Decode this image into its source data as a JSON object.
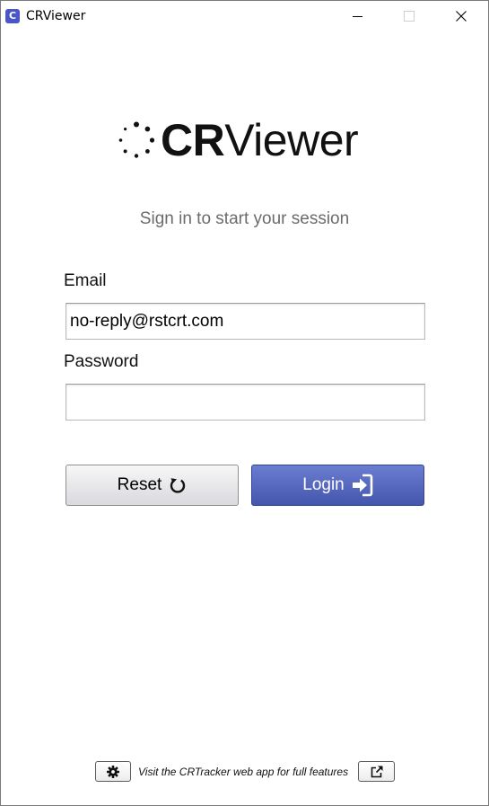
{
  "window": {
    "app_icon_glyph": "C",
    "title": "CRViewer"
  },
  "logo": {
    "bold_text": "CR",
    "light_text": "Viewer",
    "icon": "spinner-dots-icon"
  },
  "subtitle": "Sign in to start your session",
  "form": {
    "email_label": "Email",
    "email_value": "no-reply@rstcrt.com",
    "password_label": "Password",
    "password_value": ""
  },
  "buttons": {
    "reset_label": "Reset",
    "reset_icon": "refresh-icon",
    "login_label": "Login",
    "login_icon": "sign-in-icon"
  },
  "footer": {
    "settings_icon": "gear-icon",
    "text": "Visit the CRTracker web app for full features",
    "external_icon": "external-link-icon"
  },
  "colors": {
    "brand": "#4a55c8",
    "login_button": "#5062b8",
    "subtitle": "#6b6b6b"
  }
}
